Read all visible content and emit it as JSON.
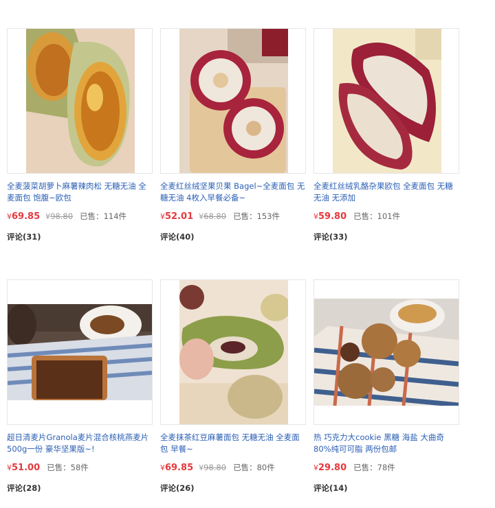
{
  "currency": "¥",
  "sold_label": "已售：",
  "unit": "件",
  "comment_label": "评论",
  "products": [
    {
      "title": "全麦菠菜胡萝卜麻薯辣肉松 无糖无油 全麦面包 饱腹~欧包",
      "price": "69.85",
      "original_price": "98.80",
      "sold": "114",
      "comments": "31"
    },
    {
      "title": "全麦红丝绒坚果贝果 Bagel~全麦面包 无糖无油 4枚入早餐必备~",
      "price": "52.01",
      "original_price": "68.80",
      "sold": "153",
      "comments": "40"
    },
    {
      "title": "全麦红丝绒乳酪杂果欧包 全麦面包 无糖无油 无添加",
      "price": "59.80",
      "original_price": "",
      "sold": "101",
      "comments": "33"
    },
    {
      "title": "超日清麦片Granola麦片混合核桃燕麦片500g一份 豪华坚果版~!",
      "price": "51.00",
      "original_price": "",
      "sold": "58",
      "comments": "28"
    },
    {
      "title": "全麦抹茶红豆麻薯面包 无糖无油 全麦面包 早餐~",
      "price": "69.85",
      "original_price": "98.80",
      "sold": "80",
      "comments": "26"
    },
    {
      "title": "热 巧克力大cookie 黑糖 海盐 大曲奇 80%纯可可脂 两份包邮",
      "price": "29.80",
      "original_price": "",
      "sold": "78",
      "comments": "14"
    }
  ]
}
